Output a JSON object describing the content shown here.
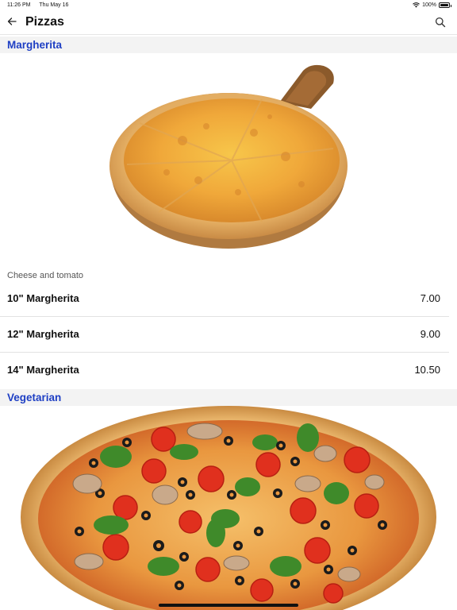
{
  "status_bar": {
    "time": "11:26 PM",
    "date": "Thu May 16",
    "battery": "100%",
    "battery_level": 1.0
  },
  "nav": {
    "title": "Pizzas",
    "back_icon": "arrow-left-icon",
    "search_icon": "search-icon"
  },
  "accent_color": "#1e3fc4",
  "sections": [
    {
      "title": "Margherita",
      "description": "Cheese and tomato",
      "items": [
        {
          "name": "10\" Margherita",
          "price": "7.00"
        },
        {
          "name": "12\" Margherita",
          "price": "9.00"
        },
        {
          "name": "14\" Margherita",
          "price": "10.50"
        }
      ]
    },
    {
      "title": "Vegetarian"
    }
  ]
}
